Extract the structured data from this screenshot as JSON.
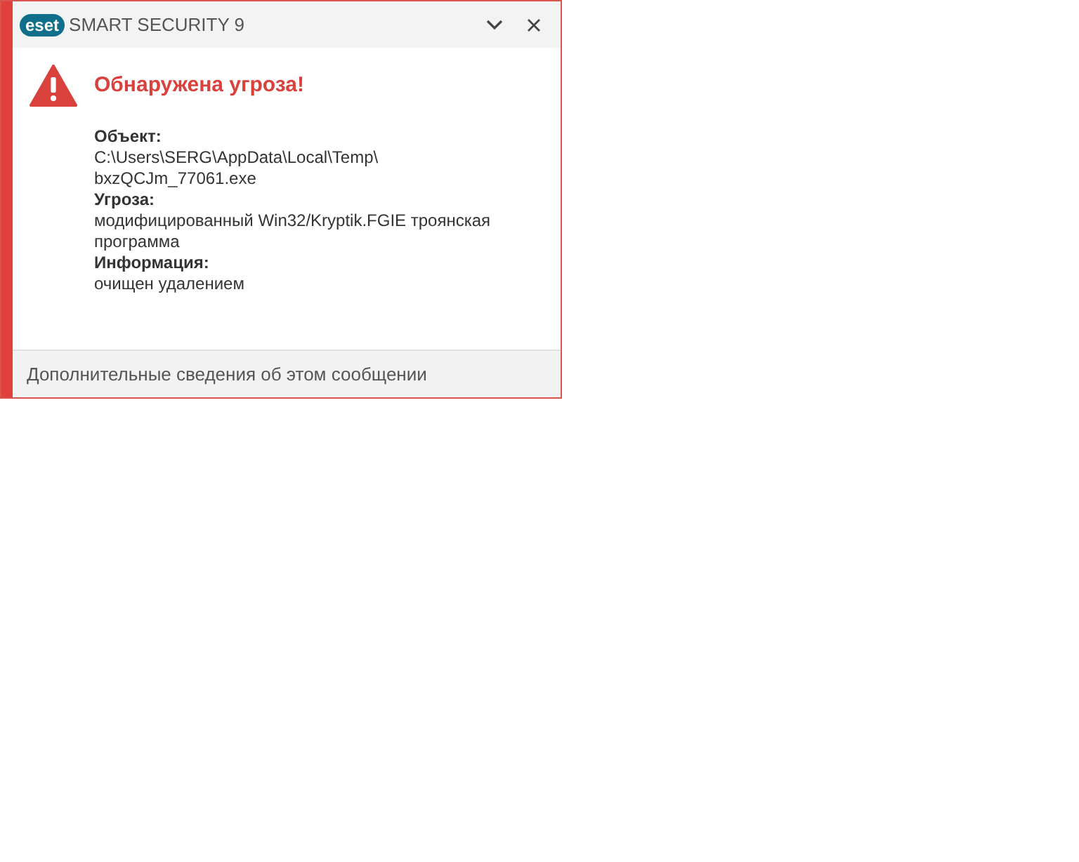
{
  "window": {
    "logo": "eset",
    "title": "SMART SECURITY 9"
  },
  "alert": {
    "heading": "Обнаружена угроза!",
    "fields": [
      {
        "label": "Объект:",
        "lines": [
          "C:\\Users\\SERG\\AppData\\Local\\Temp\\",
          "bxzQCJm_77061.exe"
        ]
      },
      {
        "label": "Угроза:",
        "lines": [
          "модифицированный Win32/Kryptik.FGIE троянская",
          "программа"
        ]
      },
      {
        "label": "Информация:",
        "lines": [
          "очищен удалением"
        ]
      }
    ]
  },
  "footer": {
    "link": "Дополнительные сведения об этом сообщении"
  }
}
